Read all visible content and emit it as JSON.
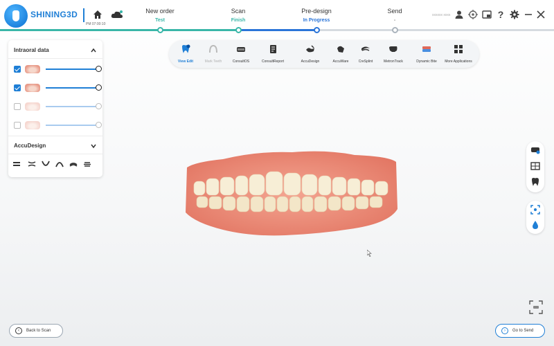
{
  "app": {
    "brand": "SHINING3D",
    "time": "PM 07:00:10",
    "user": "xxxxxx xxxx"
  },
  "steps": [
    {
      "title": "New order",
      "status": "Test",
      "color": "#39b6a8"
    },
    {
      "title": "Scan",
      "status": "Finish",
      "color": "#39b6a8"
    },
    {
      "title": "Pre-design",
      "status": "In Progress",
      "color": "#2a74d8"
    },
    {
      "title": "Send",
      "status": "-",
      "color": "#888888"
    }
  ],
  "topbar_icons": [
    "home-icon",
    "cloud-icon",
    "user-icon",
    "target-icon",
    "window-icon",
    "help-icon",
    "settings-icon",
    "minimize-icon",
    "close-icon"
  ],
  "panel": {
    "intraoral_title": "Intraoral data",
    "layers": [
      {
        "checked": true,
        "opacity": 1.0
      },
      {
        "checked": true,
        "opacity": 1.0
      },
      {
        "checked": false,
        "opacity": 1.0
      },
      {
        "checked": false,
        "opacity": 1.0
      }
    ],
    "accudesign_title": "AccuDesign"
  },
  "toolbar": {
    "tools": [
      {
        "label": "View Edit",
        "state": "active"
      },
      {
        "label": "Mark Teeth",
        "state": "disabled"
      },
      {
        "label": "ConsultOS",
        "state": "normal"
      },
      {
        "label": "ConsultReport",
        "state": "normal"
      },
      {
        "label": "AccuDesign",
        "state": "normal"
      },
      {
        "label": "AccuWare",
        "state": "normal"
      },
      {
        "label": "CreSplint",
        "state": "normal"
      },
      {
        "label": "MetronTrack",
        "state": "normal"
      },
      {
        "label": "Dynamic Bite",
        "state": "normal"
      },
      {
        "label": "More Applications",
        "state": "normal"
      }
    ]
  },
  "buttons": {
    "back": "Back to Scan",
    "next": "Go to Send"
  },
  "colors": {
    "accent": "#1f7fd6",
    "done": "#39b6a8",
    "gum": "#ee8f7c",
    "tooth": "#f6ecd2"
  }
}
